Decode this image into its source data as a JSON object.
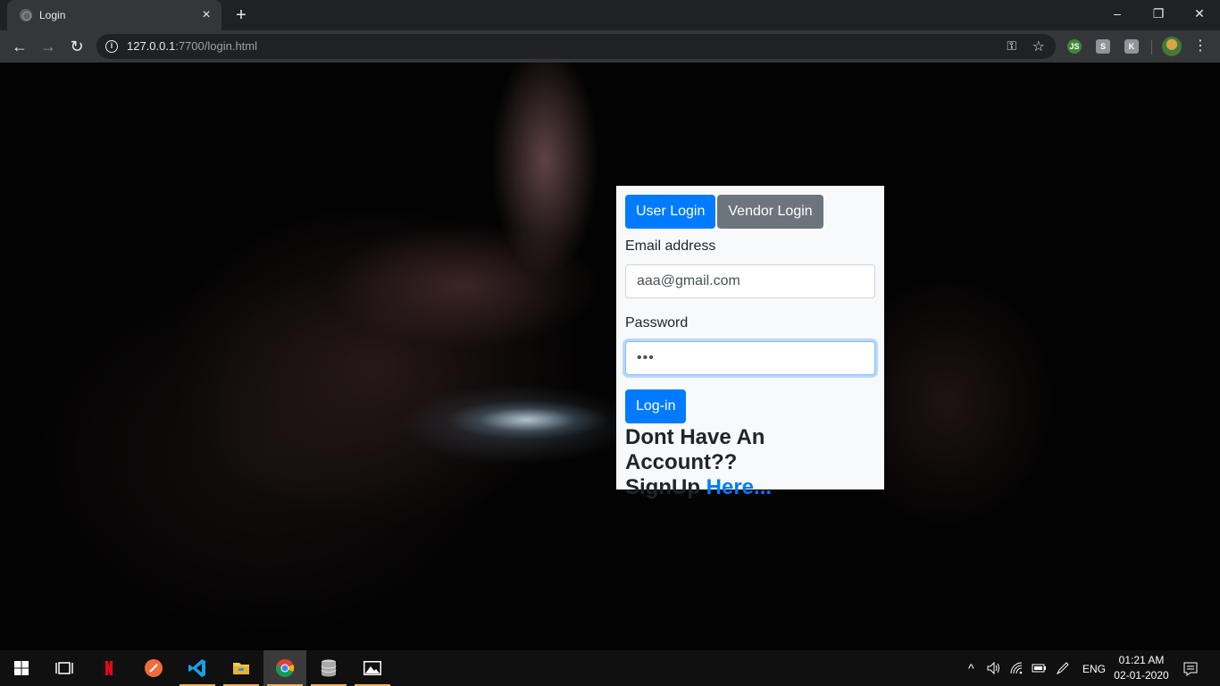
{
  "browser": {
    "tab_title": "Login",
    "new_tab": "+",
    "close_tab": "×",
    "window_controls": {
      "minimize": "–",
      "restore": "❐",
      "close": "✕"
    },
    "url_host": "127.0.0.1",
    "url_rest": ":7700/login.html",
    "back": "←",
    "forward": "→",
    "reload": "↻",
    "key": "⚿",
    "star": "☆",
    "menu": "⋮",
    "extensions": [
      {
        "icon": "nodejs-extension-icon",
        "glyph": "JS",
        "color": "#3c873a"
      },
      {
        "icon": "extension-icon-2",
        "glyph": "S",
        "color": "#8f959b"
      },
      {
        "icon": "extension-icon-3",
        "glyph": "K",
        "color": "#8f959b"
      }
    ]
  },
  "login": {
    "user_tab": "User Login",
    "vendor_tab": "Vendor Login",
    "email_label": "Email address",
    "email_value": "aaa@gmail.com",
    "password_label": "Password",
    "password_value": "•••",
    "submit_label": "Log-in",
    "signup_text_1": "Dont Have An Account??",
    "signup_text_2": "SignUp ",
    "signup_link": "Here..."
  },
  "taskbar": {
    "apps": [
      "windows-start-icon",
      "task-view-icon",
      "netflix-icon",
      "postman-icon",
      "vscode-icon",
      "file-explorer-icon",
      "chrome-icon",
      "database-icon",
      "photos-icon"
    ],
    "tray_up": "^",
    "language": "ENG",
    "time": "01:21 AM",
    "date": "02-01-2020"
  }
}
